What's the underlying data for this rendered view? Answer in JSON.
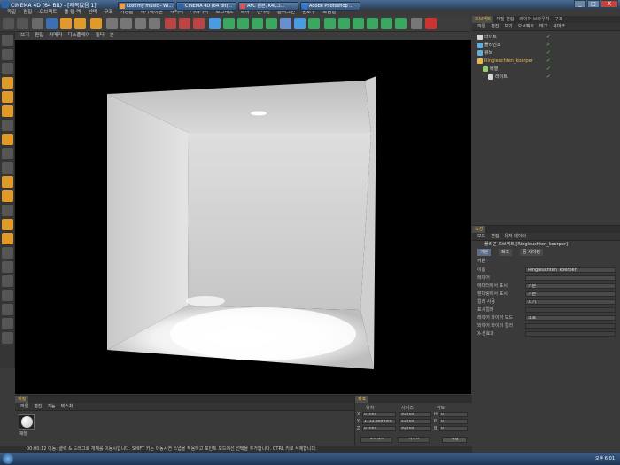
{
  "window": {
    "title": "CINEMA 4D (64 Bit) - [제목없음 1]",
    "min": "_",
    "max": "□",
    "close": "X"
  },
  "menubar": [
    "파일",
    "편집",
    "오브젝트",
    "툴 탭 렉",
    "선택",
    "구조",
    "기능들",
    "애니메이션",
    "캐릭터",
    "다이나믹",
    "모그래프",
    "헤어",
    "렌더링",
    "플러그인",
    "윈도우",
    "도움말"
  ],
  "viewport_menu": [
    "보기",
    "편집",
    "카메라",
    "디스플레이",
    "필터",
    "분"
  ],
  "object_manager": {
    "tabs": [
      "오브젝트",
      "재질 편집",
      "레이어 브라우저",
      "구조"
    ],
    "tab_active": 0,
    "menu": [
      "파일",
      "편집",
      "보기",
      "오브젝트",
      "태그",
      "북마크"
    ],
    "objects": [
      {
        "name": "라이트",
        "color": "#d8d8d8"
      },
      {
        "name": "플라인조",
        "color": "#5fb0e0"
      },
      {
        "name": "큐브",
        "color": "#5fb0e0"
      },
      {
        "name": "Ringleuchten_koerper",
        "color": "#e8b84a"
      },
      {
        "name": "배열",
        "color": "#8fd16a"
      },
      {
        "name": "라이트",
        "color": "#d8d8d8"
      }
    ],
    "check": "✓"
  },
  "attribute_manager": {
    "tab": "속성",
    "menu": [
      "모드",
      "편집",
      "유저 데이터"
    ],
    "object_title": "플라곤 오브젝트 [Ringleuchten_koerper]",
    "subtabs": [
      "기본",
      "좌표",
      "퐁 셰이딩"
    ],
    "section": "기본",
    "fields": [
      {
        "label": "이름",
        "value": "Ringleuchten_koerper"
      },
      {
        "label": "레이어",
        "value": ""
      },
      {
        "label": "에디터에서 표시",
        "value": "기본"
      },
      {
        "label": "렌더링에서 표시",
        "value": "기본"
      },
      {
        "label": "컬러 사용",
        "value": "끄기"
      },
      {
        "label": "표시컬러",
        "value": ""
      },
      {
        "label": "레이어 와이어 모드",
        "value": "조호"
      },
      {
        "label": "와이어 와이어 컬러",
        "value": ""
      },
      {
        "label": "X-선효과",
        "value": ""
      }
    ]
  },
  "material_manager": {
    "tab": "재질",
    "menu": [
      "파일",
      "편집",
      "기능",
      "텍스처"
    ],
    "material_name": "재질"
  },
  "coordinates": {
    "tab": "좌표",
    "headers": [
      "위치",
      "사이즈",
      "각도"
    ],
    "rows": [
      {
        "axis": "X",
        "pos": "0 mm",
        "size": "95 mm",
        "rot_axis": "H",
        "rot": "0 °"
      },
      {
        "axis": "Y",
        "pos": "1113.869 mm",
        "size": "25 mm",
        "rot_axis": "P",
        "rot": "0 °"
      },
      {
        "axis": "Z",
        "pos": "0 mm",
        "size": "95 mm",
        "rot_axis": "B",
        "rot": "0 °"
      }
    ],
    "mode1": "오브젝트",
    "mode2": "사이즈",
    "apply": "적용"
  },
  "status": "00:00:12  이동: 클릭 & 드래그로 개체를 이동시킵니다. SHIFT 키는 이동시연 스냅을 적용하고 포인트 모드에선 선택을 추가합니다. CTRL 키로 삭제합니다.",
  "taskbar": {
    "items": [
      {
        "label": "Lost my music - Wi...",
        "color": "#f0a030"
      },
      {
        "label": "CINEMA 4D (64 Bit)...",
        "color": "#2b62a8"
      },
      {
        "label": "AFC 원본, K4l,그...",
        "color": "#e05050"
      },
      {
        "label": "Adobe Photoshop ...",
        "color": "#2d7ad6"
      }
    ],
    "clock": "오후 6:01"
  },
  "colors": {
    "accent": "#e8b84a",
    "check": "#5ad04a"
  }
}
